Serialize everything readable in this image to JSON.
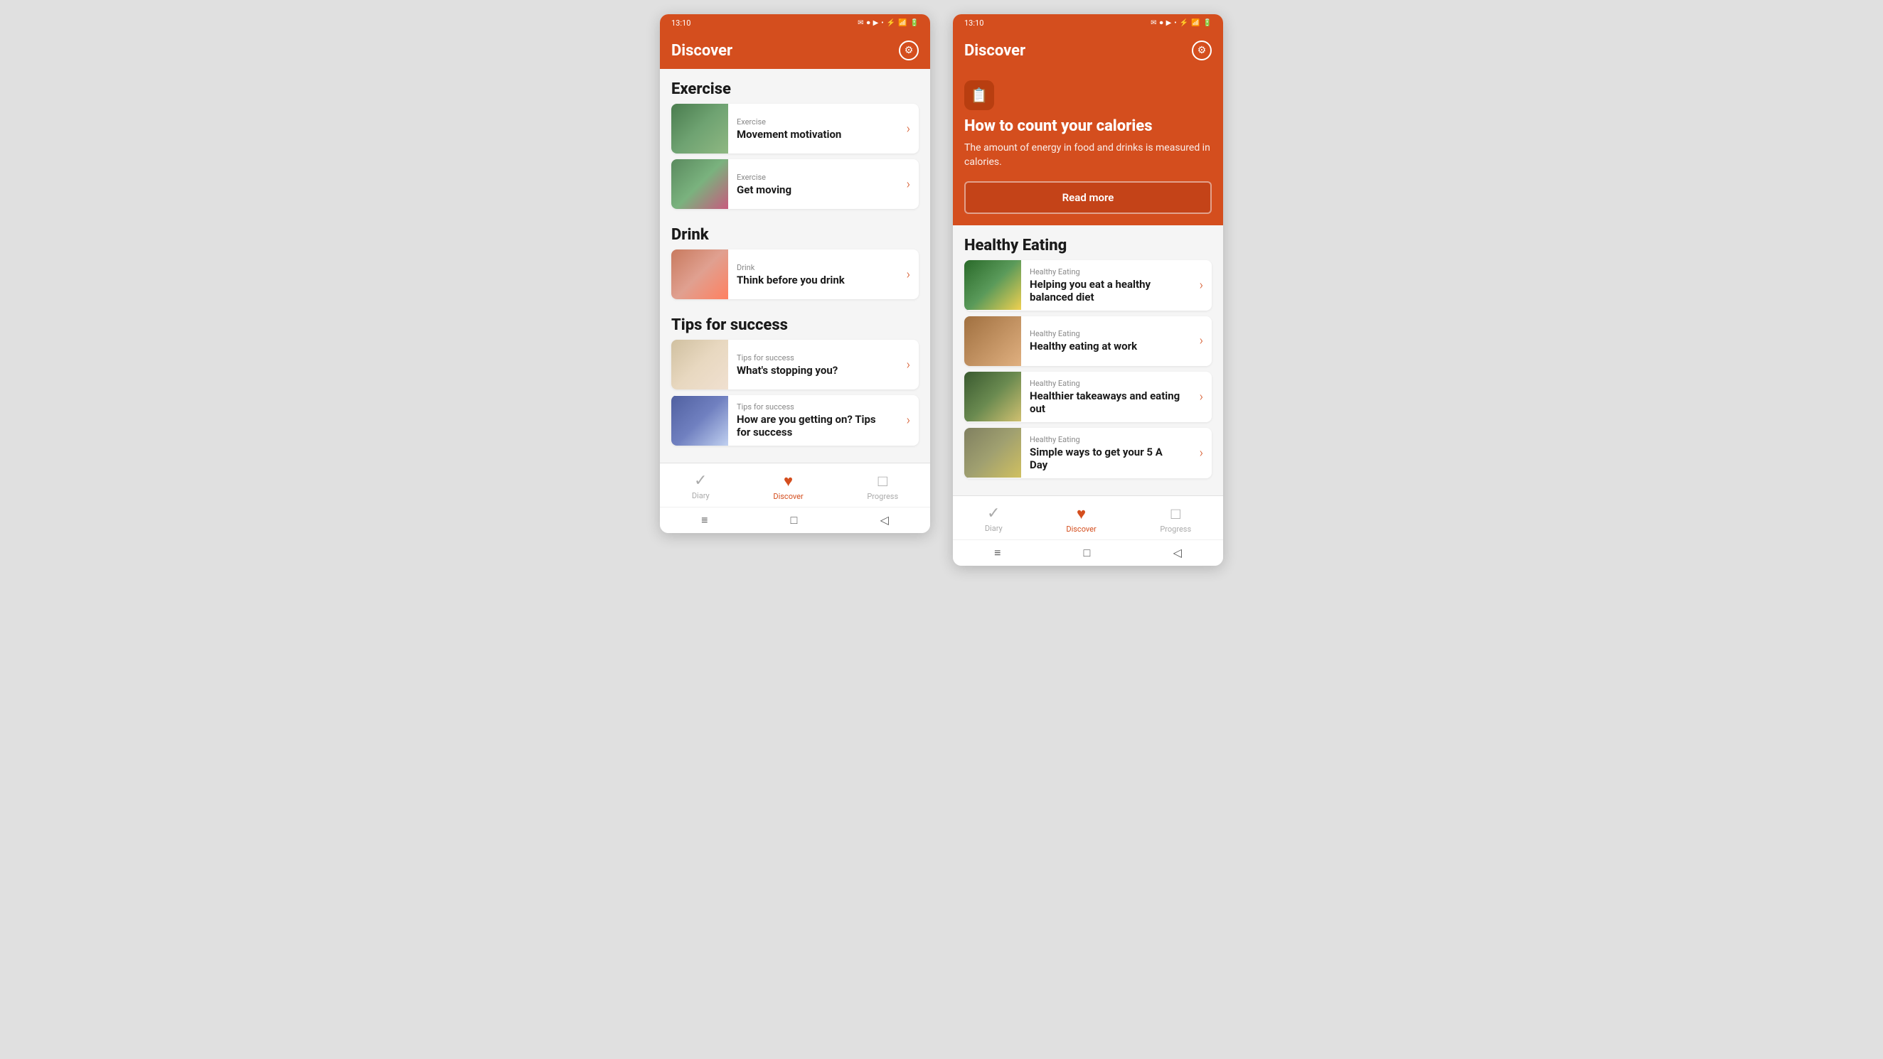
{
  "left_phone": {
    "status_bar": {
      "time": "13:10",
      "left_icons": "13:10 ✉ ⏺ 📷 ▶ •",
      "right_icons": "⚡ 📶 ▌ 🔋"
    },
    "header": {
      "title": "Discover",
      "settings_label": "⚙"
    },
    "sections": [
      {
        "id": "exercise",
        "heading": "Exercise",
        "items": [
          {
            "category": "Exercise",
            "title": "Movement motivation",
            "img_class": "img-exercise1"
          },
          {
            "category": "Exercise",
            "title": "Get moving",
            "img_class": "img-exercise2"
          }
        ]
      },
      {
        "id": "drink",
        "heading": "Drink",
        "items": [
          {
            "category": "Drink",
            "title": "Think before you drink",
            "img_class": "img-drink"
          }
        ]
      },
      {
        "id": "tips",
        "heading": "Tips for success",
        "items": [
          {
            "category": "Tips for success",
            "title": "What's stopping you?",
            "img_class": "img-tips1"
          },
          {
            "category": "Tips for success",
            "title": "How are you getting on? Tips for success",
            "img_class": "img-tips2"
          }
        ]
      }
    ],
    "bottom_nav": [
      {
        "label": "Diary",
        "icon": "✓",
        "active": false
      },
      {
        "label": "Discover",
        "icon": "♥",
        "active": true
      },
      {
        "label": "Progress",
        "icon": "□",
        "active": false
      }
    ],
    "android_nav": [
      "≡",
      "□",
      "◁"
    ]
  },
  "right_phone": {
    "status_bar": {
      "time": "13:10"
    },
    "header": {
      "title": "Discover",
      "settings_label": "⚙"
    },
    "hero": {
      "icon": "📋",
      "title": "How to count your calories",
      "subtitle": "The amount of energy in food and drinks is measured in calories.",
      "read_more": "Read more"
    },
    "healthy_eating": {
      "heading": "Healthy Eating",
      "items": [
        {
          "category": "Healthy Eating",
          "title": "Helping you eat a healthy balanced diet",
          "img_class": "img-healthy1"
        },
        {
          "category": "Healthy Eating",
          "title": "Healthy eating at work",
          "img_class": "img-healthy2"
        },
        {
          "category": "Healthy Eating",
          "title": "Healthier takeaways and eating out",
          "img_class": "img-healthy3"
        },
        {
          "category": "Healthy Eating",
          "title": "Simple ways to get your 5 A Day",
          "img_class": "img-healthy4"
        }
      ]
    },
    "bottom_nav": [
      {
        "label": "Diary",
        "icon": "✓",
        "active": false
      },
      {
        "label": "Discover",
        "icon": "♥",
        "active": true
      },
      {
        "label": "Progress",
        "icon": "□",
        "active": false
      }
    ],
    "android_nav": [
      "≡",
      "□",
      "◁"
    ]
  }
}
